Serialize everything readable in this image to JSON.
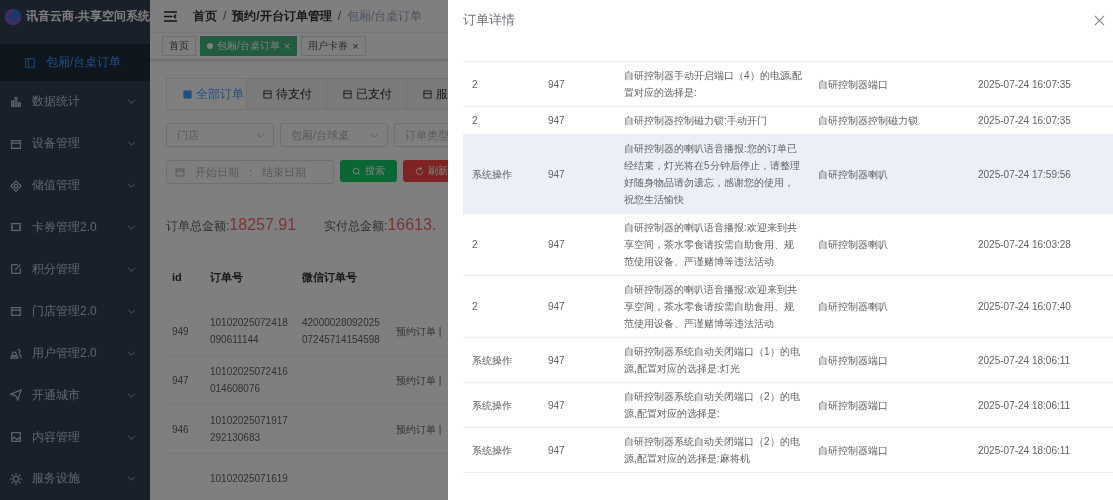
{
  "sidebar": {
    "logo_text": "讯音云商-共享空间系统",
    "items": [
      {
        "label": "包厢/台桌订单",
        "kind": "sub",
        "selected": true
      },
      {
        "label": "数据统计",
        "kind": "menu",
        "selected": false
      },
      {
        "label": "设备管理",
        "kind": "menu",
        "selected": false
      },
      {
        "label": "储值管理",
        "kind": "menu",
        "selected": false
      },
      {
        "label": "卡券管理2.0",
        "kind": "menu",
        "selected": false
      },
      {
        "label": "积分管理",
        "kind": "menu",
        "selected": false
      },
      {
        "label": "门店管理2.0",
        "kind": "menu",
        "selected": false
      },
      {
        "label": "用户管理2.0",
        "kind": "menu",
        "selected": false
      },
      {
        "label": "开通城市",
        "kind": "menu",
        "selected": false
      },
      {
        "label": "内容管理",
        "kind": "menu",
        "selected": false
      },
      {
        "label": "服务设施",
        "kind": "menu",
        "selected": false
      }
    ]
  },
  "breadcrumb": [
    "首页",
    "/",
    "预约/开台订单管理",
    "/",
    "包厢/台桌订单"
  ],
  "tags": [
    {
      "label": "首页",
      "selected": false
    },
    {
      "label": "包厢/台桌订单",
      "close": "×",
      "selected": true
    },
    {
      "label": "用户卡券",
      "close": "×",
      "selected": false
    }
  ],
  "order_tabs": [
    {
      "label": "全部订单",
      "selected": true
    },
    {
      "label": "待支付",
      "selected": false
    },
    {
      "label": "已支付",
      "selected": false
    },
    {
      "label": "服",
      "selected": false
    }
  ],
  "filters": [
    {
      "placeholder": "门店"
    },
    {
      "placeholder": "包厢/台球桌"
    },
    {
      "placeholder": "订单类型"
    }
  ],
  "date_range": {
    "start_placeholder": "开始日期",
    "separator": ":",
    "end_placeholder": "结束日期"
  },
  "buttons": [
    {
      "label": "搜索",
      "kind": "search"
    },
    {
      "label": "刷新",
      "kind": "refresh"
    }
  ],
  "totals": [
    {
      "label": "订单总金额:",
      "value": "18257.91"
    },
    {
      "label": "实付总金额:",
      "value": "16613."
    }
  ],
  "orders": {
    "columns": [
      "id",
      "订单号",
      "微信订单号"
    ],
    "rows": [
      {
        "id": "949",
        "order_no": "10102025072418090611144",
        "wechat_no": "4200002809202507245714154598",
        "type": "预约订单 |"
      },
      {
        "id": "947",
        "order_no": "10102025072416014608076",
        "type": "预约订单 |"
      },
      {
        "id": "946",
        "order_no": "10102025071917292130683",
        "type": "预约订单 |"
      },
      {
        "order_no": "10102025071619"
      }
    ]
  },
  "drawer": {
    "title": "订单详情",
    "rows": [
      {
        "column_1": "2",
        "column_2": "947",
        "column_3": "自研控制器手动开启端口（4）的电源,配置对应的选择是:",
        "column_4": "自研控制器端口",
        "column_5": "2025-07-24 16:07:35",
        "selected": false
      },
      {
        "column_1": "2",
        "column_2": "947",
        "column_3": "自研控制器控制磁力锁:手动开门",
        "column_4": "自研控制器控制磁力锁",
        "column_5": "2025-07-24 16:07:35",
        "selected": false
      },
      {
        "column_1": "系统操作",
        "column_2": "947",
        "column_3": "自研控制器的喇叭语音播报:您的订单已经结束，灯光将在5分钟后停止，请整理好随身物品请勿遗忘，感谢您的使用，祝您生活愉快",
        "column_4": "自研控制器喇叭",
        "column_5": "2025-07-24 17:59:56",
        "selected": true
      },
      {
        "column_1": "2",
        "column_2": "947",
        "column_3": "自研控制器的喇叭语音播报:欢迎来到共享空间，茶水零食请按需自助食用、规范使用设备、严谨赌博等违法活动",
        "column_4": "自研控制器喇叭",
        "column_5": "2025-07-24 16:03:28",
        "selected": false
      },
      {
        "column_1": "2",
        "column_2": "947",
        "column_3": "自研控制器的喇叭语音播报:欢迎来到共享空间，茶水零食请按需自助食用、规范使用设备、严谨赌博等违法活动",
        "column_4": "自研控制器喇叭",
        "column_5": "2025-07-24 16:07:40",
        "selected": false
      },
      {
        "column_1": "系统操作",
        "column_2": "947",
        "column_3": "自研控制器系统自动关闭端口（1）的电源,配置对应的选择是:灯光",
        "column_4": "自研控制器端口",
        "column_5": "2025-07-24 18:06:11",
        "selected": false
      },
      {
        "column_1": "系统操作",
        "column_2": "947",
        "column_3": "自研控制器系统自动关闭端口（2）的电源,配置对应的选择是:",
        "column_4": "自研控制器端口",
        "column_5": "2025-07-24 18:06:11",
        "selected": false
      },
      {
        "column_1": "系统操作",
        "column_2": "947",
        "column_3": "自研控制器系统自动关闭端口（2）的电源,配置对应的选择是:麻将机",
        "column_4": "自研控制器端口",
        "column_5": "2025-07-24 18:06:11",
        "selected": false
      }
    ]
  }
}
